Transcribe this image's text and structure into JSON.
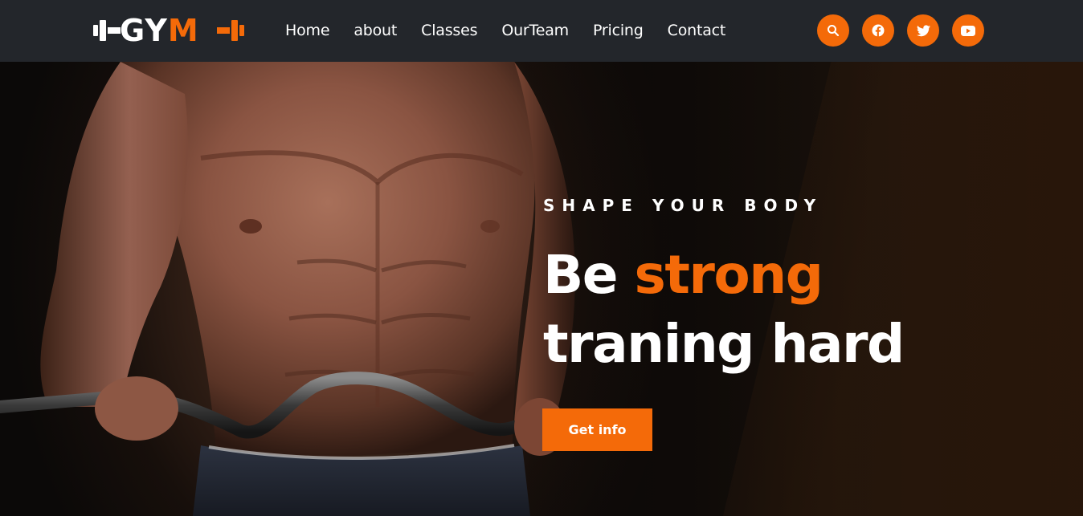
{
  "brand": {
    "logo_main": "GY",
    "logo_accent": "M",
    "accent_color": "#f46a09",
    "navbar_bg": "#23262b"
  },
  "nav": {
    "links": [
      "Home",
      "about",
      "Classes",
      "OurTeam",
      "Pricing",
      "Contact"
    ]
  },
  "nav_icons": [
    "search-icon",
    "facebook-icon",
    "twitter-icon",
    "youtube-icon"
  ],
  "hero": {
    "subtitle": "SHAPE YOUR BODY",
    "heading_part1": "Be ",
    "heading_accent": "strong",
    "heading_line2": "traning hard",
    "cta_label": "Get info",
    "image": "bodybuilder-holding-barbell"
  }
}
